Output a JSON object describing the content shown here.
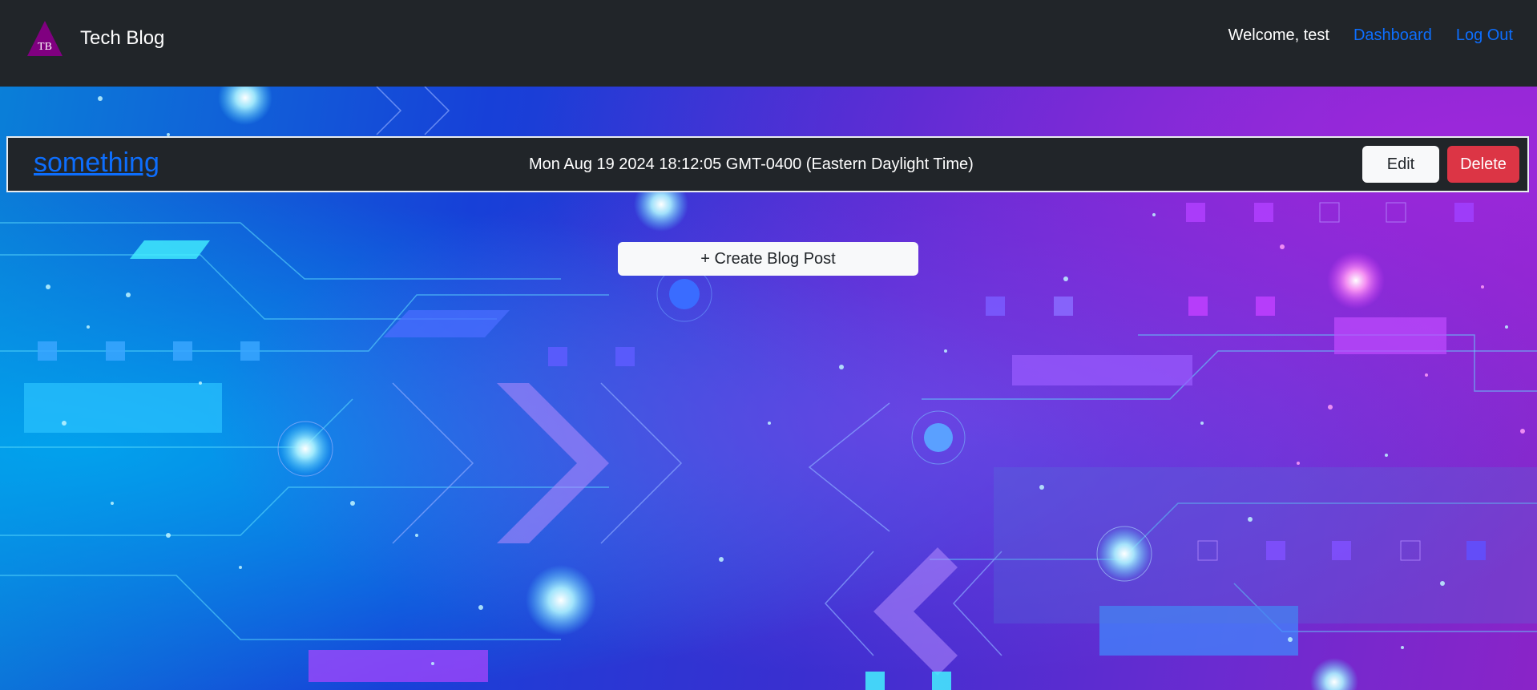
{
  "navbar": {
    "brand_initials": "TB",
    "brand_name": "Tech Blog",
    "welcome_text": "Welcome, test",
    "links": [
      {
        "label": "Dashboard"
      },
      {
        "label": "Log Out"
      }
    ]
  },
  "post": {
    "title": "something",
    "date": "Mon Aug 19 2024 18:12:05 GMT-0400 (Eastern Daylight Time)",
    "edit_label": "Edit",
    "delete_label": "Delete"
  },
  "create_button": {
    "label": "+ Create Blog Post"
  },
  "colors": {
    "navbar_bg": "#212529",
    "link": "#0d6efd",
    "danger": "#dc3545",
    "logo": "#800080"
  }
}
